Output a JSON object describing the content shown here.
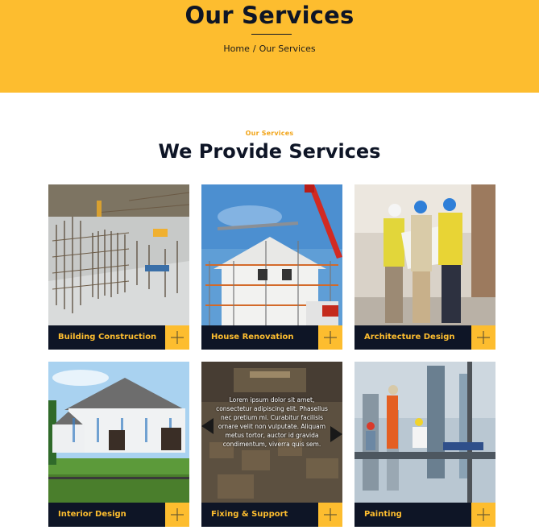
{
  "hero": {
    "title": "Our Services",
    "breadcrumb": {
      "home": "Home",
      "separator": "/",
      "current": "Our Services"
    }
  },
  "section": {
    "eyebrow": "Our Services",
    "title": "We Provide Services"
  },
  "services": [
    {
      "label": "Building Construction"
    },
    {
      "label": "House Renovation"
    },
    {
      "label": "Architecture Design"
    },
    {
      "label": "Interior Design"
    },
    {
      "label": "Fixing & Support",
      "overlay_text": "Lorem ipsum dolor sit amet, consectetur adipiscing elit. Phasellus nec pretium mi. Curabitur facilisis ornare velit non vulputate. Aliquam metus tortor, auctor id gravida condimentum, viverra quis sem."
    },
    {
      "label": "Painting"
    }
  ],
  "colors": {
    "accent": "#fdbd2f",
    "dark": "#0e1526",
    "eyebrow": "#f2a51a"
  },
  "icons": {
    "card_action": "plus-icon"
  }
}
